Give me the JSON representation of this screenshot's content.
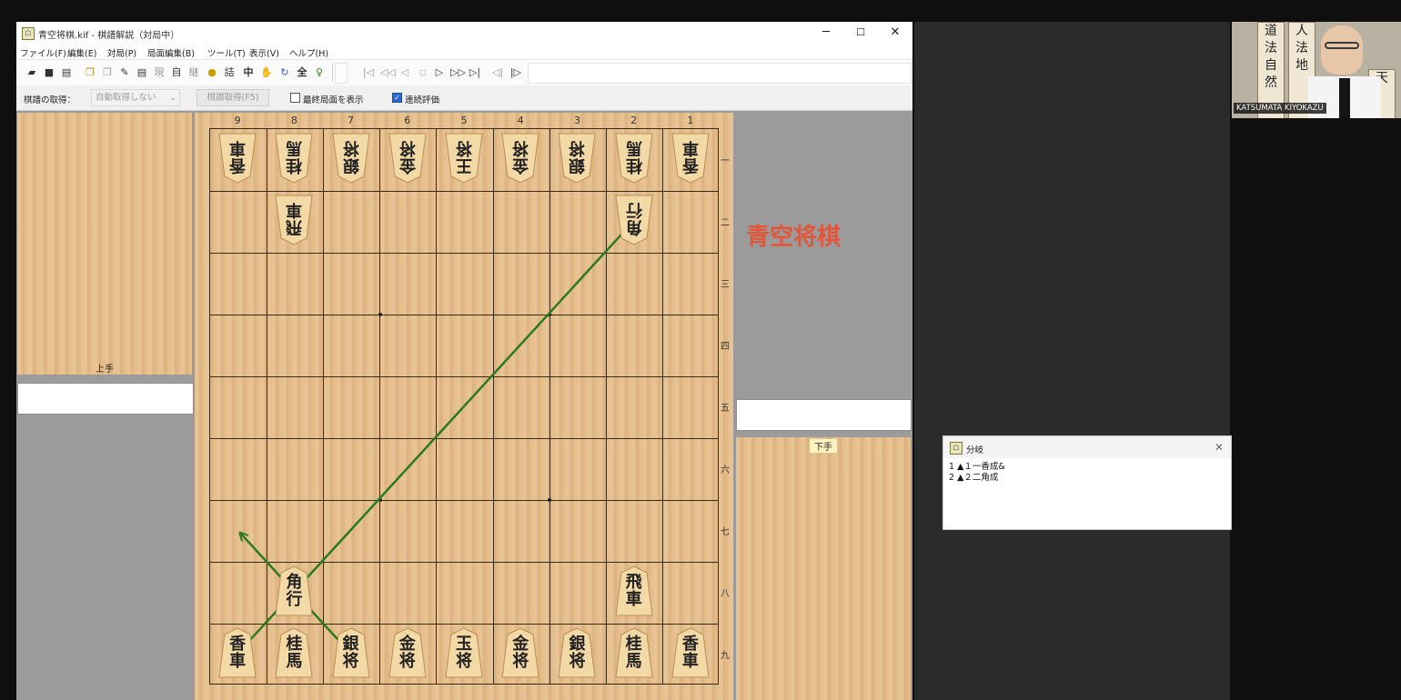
{
  "window": {
    "title": "青空将棋.kif - 棋譜解説（対局中）",
    "minimize": "─",
    "maximize": "☐",
    "close": "✕"
  },
  "menu": [
    "ファイル(F)",
    "編集(E)",
    "対局(P)",
    "局面編集(B)",
    "ツール(T)",
    "表示(V)",
    "ヘルプ(H)"
  ],
  "toolbar": {
    "text_buttons": [
      "現",
      "自",
      "継",
      "詰",
      "中",
      "全"
    ]
  },
  "options": {
    "kifu_label": "棋譜の取得：",
    "auto_value": "自動取得しない",
    "fetch_button": "棋譜取得(F5)",
    "show_last": "最終局面を表示",
    "continuous": "連続評価"
  },
  "board": {
    "col_labels": [
      "9",
      "8",
      "7",
      "6",
      "5",
      "4",
      "3",
      "2",
      "1"
    ],
    "row_labels": [
      "一",
      "二",
      "三",
      "四",
      "五",
      "六",
      "七",
      "八",
      "九"
    ],
    "pieces": [
      {
        "file": 9,
        "rank": 1,
        "top": "香",
        "bottom": "車",
        "inverted": true
      },
      {
        "file": 8,
        "rank": 1,
        "top": "桂",
        "bottom": "馬",
        "inverted": true
      },
      {
        "file": 7,
        "rank": 1,
        "top": "銀",
        "bottom": "将",
        "inverted": true
      },
      {
        "file": 6,
        "rank": 1,
        "top": "金",
        "bottom": "将",
        "inverted": true
      },
      {
        "file": 5,
        "rank": 1,
        "top": "王",
        "bottom": "将",
        "inverted": true
      },
      {
        "file": 4,
        "rank": 1,
        "top": "金",
        "bottom": "将",
        "inverted": true
      },
      {
        "file": 3,
        "rank": 1,
        "top": "銀",
        "bottom": "将",
        "inverted": true
      },
      {
        "file": 2,
        "rank": 1,
        "top": "桂",
        "bottom": "馬",
        "inverted": true
      },
      {
        "file": 1,
        "rank": 1,
        "top": "香",
        "bottom": "車",
        "inverted": true
      },
      {
        "file": 8,
        "rank": 2,
        "top": "飛",
        "bottom": "車",
        "inverted": true
      },
      {
        "file": 2,
        "rank": 2,
        "top": "角",
        "bottom": "行",
        "inverted": true
      },
      {
        "file": 8,
        "rank": 8,
        "top": "角",
        "bottom": "行",
        "inverted": false
      },
      {
        "file": 2,
        "rank": 8,
        "top": "飛",
        "bottom": "車",
        "inverted": false
      },
      {
        "file": 9,
        "rank": 9,
        "top": "香",
        "bottom": "車",
        "inverted": false
      },
      {
        "file": 8,
        "rank": 9,
        "top": "桂",
        "bottom": "馬",
        "inverted": false
      },
      {
        "file": 7,
        "rank": 9,
        "top": "銀",
        "bottom": "将",
        "inverted": false
      },
      {
        "file": 6,
        "rank": 9,
        "top": "金",
        "bottom": "将",
        "inverted": false
      },
      {
        "file": 5,
        "rank": 9,
        "top": "玉",
        "bottom": "将",
        "inverted": false
      },
      {
        "file": 4,
        "rank": 9,
        "top": "金",
        "bottom": "将",
        "inverted": false
      },
      {
        "file": 3,
        "rank": 9,
        "top": "銀",
        "bottom": "将",
        "inverted": false
      },
      {
        "file": 2,
        "rank": 9,
        "top": "桂",
        "bottom": "馬",
        "inverted": false
      },
      {
        "file": 1,
        "rank": 9,
        "top": "香",
        "bottom": "車",
        "inverted": false
      }
    ],
    "arrow_color": "#2b7a1f"
  },
  "stands": {
    "gote_label": "上手",
    "sente_label": "下手"
  },
  "watermark": "青空将棋",
  "branch": {
    "title": "分岐",
    "close": "✕",
    "lines": [
      "1 ▲１一香成&",
      "2 ▲２二角成"
    ]
  },
  "video": {
    "name": "KATSUMATA KIYOKAZU",
    "scroll1": [
      "道",
      "法",
      "自",
      "然"
    ],
    "scroll2": [
      "人",
      "法",
      "地"
    ],
    "scroll3": [
      "天"
    ]
  },
  "colors": {
    "watermark": "#e0573b",
    "checkbox_on": "#2a6bd1"
  }
}
